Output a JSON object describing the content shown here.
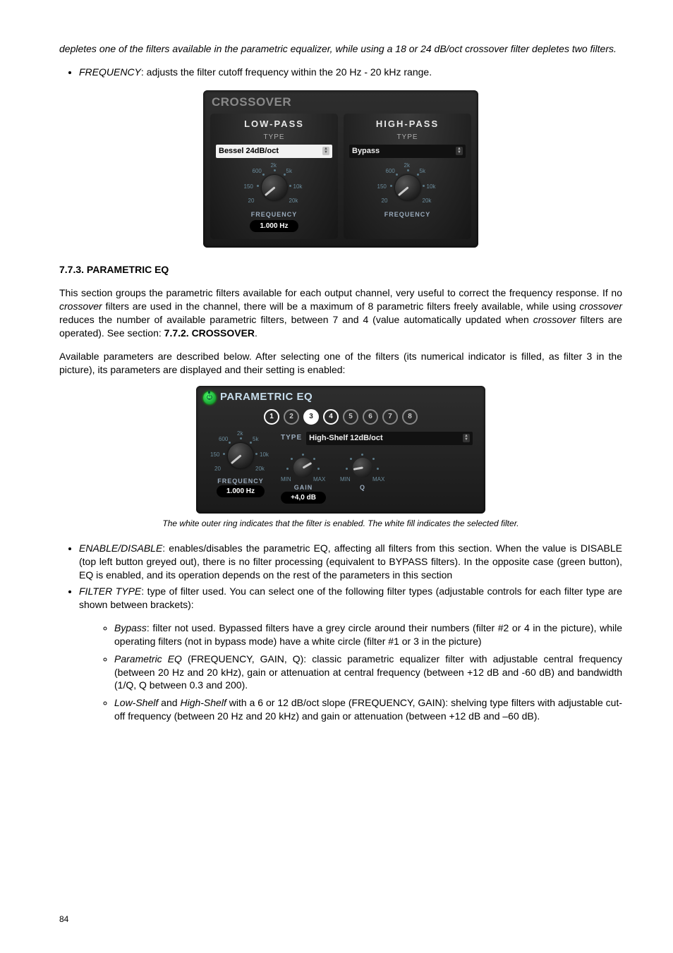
{
  "intro_italic": "depletes one of the filters available in the parametric equalizer, while using a 18 or 24 dB/oct crossover filter depletes two filters.",
  "freq_bullet": {
    "label": "FREQUENCY",
    "rest": ": adjusts the filter cutoff frequency within the 20 Hz - 20 kHz range."
  },
  "crossover": {
    "title": "CROSSOVER",
    "lowpass": {
      "head": "LOW-PASS",
      "type_label": "TYPE",
      "type_value": "Bessel 24dB/oct",
      "ticks": {
        "t20": "20",
        "t150": "150",
        "t600": "600",
        "t2k": "2k",
        "t5k": "5k",
        "t10k": "10k",
        "t20k": "20k"
      },
      "freq_label": "FREQUENCY",
      "freq_value": "1.000 Hz"
    },
    "highpass": {
      "head": "HIGH-PASS",
      "type_label": "TYPE",
      "type_value": "Bypass",
      "ticks": {
        "t20": "20",
        "t150": "150",
        "t600": "600",
        "t2k": "2k",
        "t5k": "5k",
        "t10k": "10k",
        "t20k": "20k"
      },
      "freq_label": "FREQUENCY"
    }
  },
  "sec_heading": "7.7.3. PARAMETRIC EQ",
  "para1": {
    "a": "This section groups the parametric filters available for each output channel, very useful to correct the frequency response. If no ",
    "b": "crossover",
    "c": " filters are used in the channel, there will be a maximum of 8 parametric filters freely available, while using ",
    "d": "crossover",
    "e": " reduces the number of available parametric filters, between 7 and 4 (value automatically updated when ",
    "f": "crossover",
    "g": " filters are operated). See section: ",
    "h": "7.7.2. CROSSOVER",
    "i": "."
  },
  "para2": "Available parameters are described below. After selecting one of the filters (its numerical indicator is filled, as filter 3 in the picture), its parameters are displayed and their setting is enabled:",
  "peq": {
    "title": "PARAMETRIC EQ",
    "filters": [
      {
        "n": "1",
        "state": "enabled-ring"
      },
      {
        "n": "2",
        "state": ""
      },
      {
        "n": "3",
        "state": "filled"
      },
      {
        "n": "4",
        "state": "enabled-ring"
      },
      {
        "n": "5",
        "state": ""
      },
      {
        "n": "6",
        "state": ""
      },
      {
        "n": "7",
        "state": ""
      },
      {
        "n": "8",
        "state": ""
      }
    ],
    "type_label": "TYPE",
    "type_value": "High-Shelf 12dB/oct",
    "freq": {
      "ticks": {
        "t20": "20",
        "t150": "150",
        "t600": "600",
        "t2k": "2k",
        "t5k": "5k",
        "t10k": "10k",
        "t20k": "20k"
      },
      "label": "FREQUENCY",
      "value": "1.000 Hz"
    },
    "gain": {
      "min": "MIN",
      "max": "MAX",
      "label": "GAIN",
      "value": "+4,0 dB"
    },
    "q": {
      "min": "MIN",
      "max": "MAX",
      "label": "Q"
    }
  },
  "caption": "The white outer ring indicates that the filter is enabled. The white fill indicates the selected filter.",
  "b_enable": {
    "label": "ENABLE/DISABLE",
    "rest": ": enables/disables the parametric EQ, affecting all filters from this section. When the value is DISABLE (top left button greyed out), there is no filter processing (equivalent to BYPASS filters). In the opposite case (green button), EQ is enabled, and its operation depends on the rest of the parameters in this section"
  },
  "b_type": {
    "label": "FILTER TYPE",
    "rest": ": type of filter used. You can select one of the following filter types (adjustable controls for each filter type are shown between brackets):"
  },
  "sub_bypass": {
    "label": "Bypass",
    "rest": ": filter not used. Bypassed filters have a grey circle around their numbers (filter #2 or 4 in the picture), while operating filters (not in bypass mode) have a white circle (filter #1 or 3 in the picture)"
  },
  "sub_peq": {
    "label": "Parametric EQ",
    "rest": " (FREQUENCY, GAIN, Q): classic parametric equalizer filter with adjustable central frequency (between 20 Hz and 20 kHz), gain or attenuation at central frequency (between +12 dB and -60 dB) and bandwidth (1/Q, Q between 0.3 and 200)."
  },
  "sub_shelf": {
    "a": "Low-Shelf",
    "b": " and ",
    "c": "High-Shelf",
    "d": " with a 6 or 12 dB/oct slope (FREQUENCY, GAIN): shelving type filters with adjustable cut-off frequency (between 20 Hz and 20 kHz) and gain or attenuation (between +12 dB and –60 dB)."
  },
  "page_number": "84"
}
